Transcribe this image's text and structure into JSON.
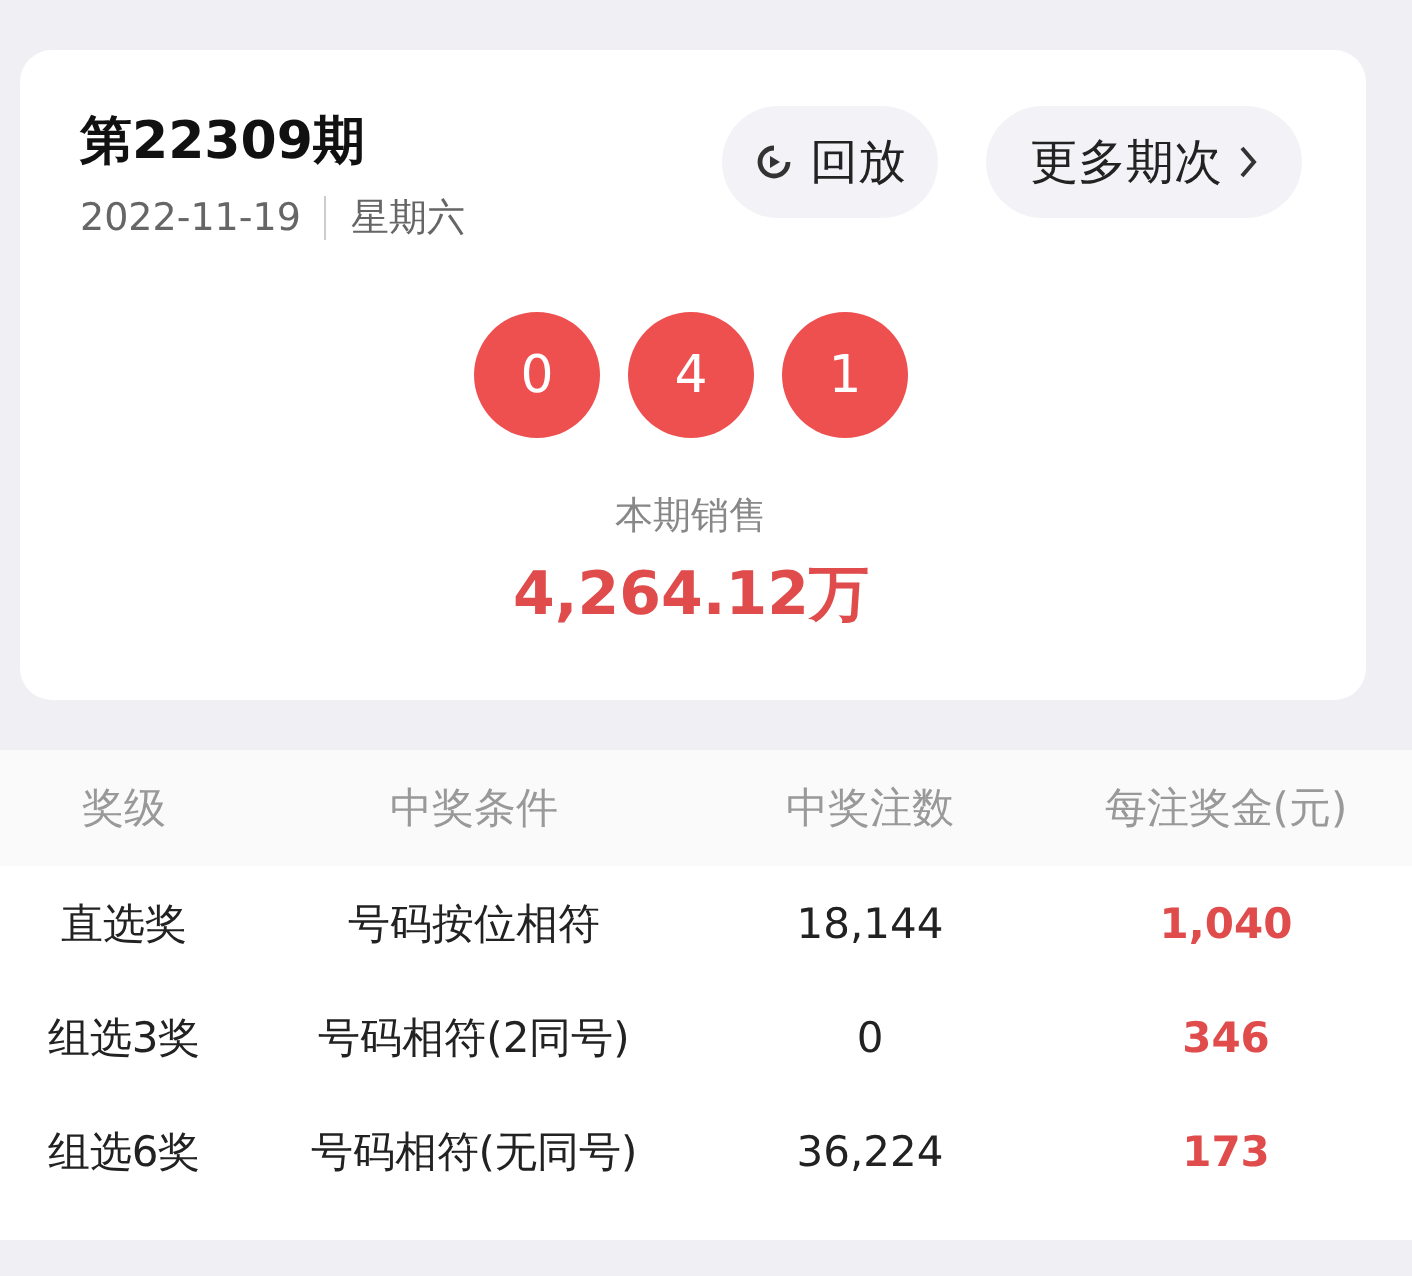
{
  "issue": {
    "title": "第22309期",
    "date": "2022-11-19",
    "weekday": "星期六"
  },
  "buttons": [
    {
      "label": "回放",
      "kind": "replay"
    },
    {
      "label": "更多期次",
      "kind": "more"
    }
  ],
  "balls": [
    "0",
    "4",
    "1"
  ],
  "sales": {
    "label": "本期销售",
    "value": "4,264.12万"
  },
  "table": {
    "columns": [
      "奖级",
      "中奖条件",
      "中奖注数",
      "每注奖金(元)"
    ],
    "rows": [
      {
        "level": "直选奖",
        "condition": "号码按位相符",
        "count": "18,144",
        "prize": "1,040"
      },
      {
        "level": "组选3奖",
        "condition": "号码相符(2同号)",
        "count": "0",
        "prize": "346"
      },
      {
        "level": "组选6奖",
        "condition": "号码相符(无同号)",
        "count": "36,224",
        "prize": "173"
      }
    ]
  }
}
